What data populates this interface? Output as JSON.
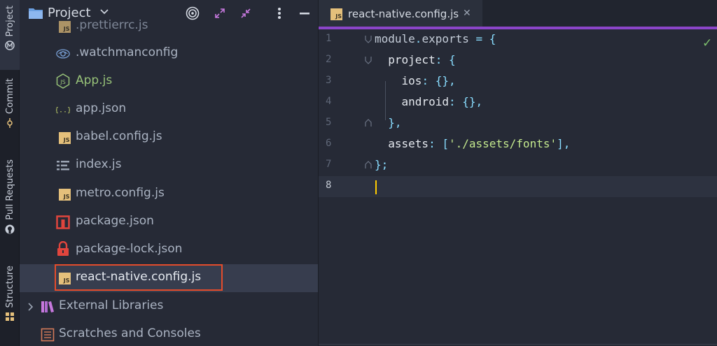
{
  "sidebar_tabs": {
    "project": "Project",
    "commit": "Commit",
    "pull_requests": "Pull Requests",
    "structure": "Structure"
  },
  "panel": {
    "title": "Project",
    "icons": [
      "folder-icon",
      "chevron-down-icon",
      "target-icon",
      "expand-icon",
      "collapse-icon",
      "more-icon",
      "minimize-icon"
    ]
  },
  "tree": {
    "items": [
      {
        "label": ".prettierrc.js",
        "icon": "js-file-icon"
      },
      {
        "label": ".watchmanconfig",
        "icon": "eye-icon"
      },
      {
        "label": "App.js",
        "icon": "nodejs-icon"
      },
      {
        "label": "app.json",
        "icon": "json-icon"
      },
      {
        "label": "babel.config.js",
        "icon": "js-file-icon"
      },
      {
        "label": "index.js",
        "icon": "text-file-icon"
      },
      {
        "label": "metro.config.js",
        "icon": "js-file-icon"
      },
      {
        "label": "package.json",
        "icon": "npm-icon"
      },
      {
        "label": "package-lock.json",
        "icon": "lock-icon"
      },
      {
        "label": "react-native.config.js",
        "icon": "js-file-icon"
      },
      {
        "label": "External Libraries",
        "icon": "library-icon"
      },
      {
        "label": "Scratches and Consoles",
        "icon": "scratches-icon"
      }
    ]
  },
  "editor": {
    "tab_title": "react-native.config.js",
    "badge": "JS",
    "line_numbers": [
      "1",
      "2",
      "3",
      "4",
      "5",
      "6",
      "7",
      "8"
    ],
    "lines": [
      {
        "a": "module",
        "b": ".",
        "c": "exports",
        "d": " = {"
      },
      {
        "a": "  project",
        "b": ": {"
      },
      {
        "a": "    ios",
        "b": ": {},"
      },
      {
        "a": "    android",
        "b": ": {},"
      },
      {
        "a": "  },"
      },
      {
        "a": "  assets",
        "b": ": [",
        "c": "'./assets/fonts'",
        "d": "],"
      },
      {
        "a": "};"
      },
      {
        "a": ""
      }
    ]
  },
  "colors": {
    "accent_tab": "#8b45c9",
    "selection_box": "#e44c2b",
    "js_badge": "#e5c07b",
    "string": "#c3e88d"
  }
}
